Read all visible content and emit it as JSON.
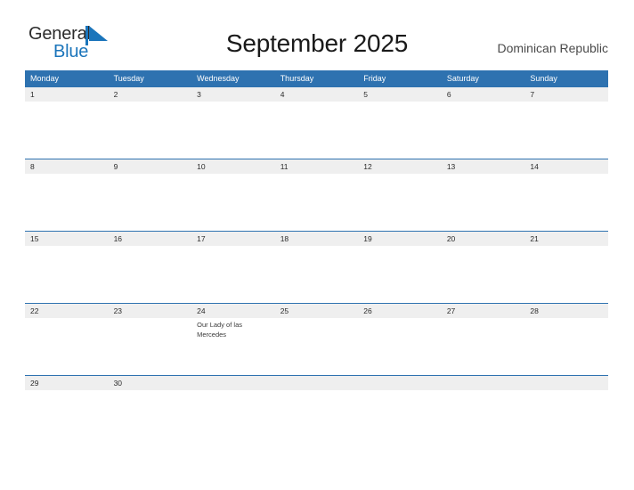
{
  "brand": {
    "name_part1": "General",
    "name_part2": "Blue",
    "flag_icon": "blue-flag-triangle",
    "color_primary": "#1b75bb"
  },
  "header": {
    "title": "September 2025",
    "country": "Dominican Republic"
  },
  "theme": {
    "header_blue": "#2e72b0",
    "band_gray": "#efefef",
    "text_dark": "#2b2b2b",
    "page_background": "#ffffff"
  },
  "calendar": {
    "month": "September",
    "year": "2025",
    "weekday_headers": [
      "Monday",
      "Tuesday",
      "Wednesday",
      "Thursday",
      "Friday",
      "Saturday",
      "Sunday"
    ],
    "weeks": [
      {
        "days": [
          {
            "date": "1",
            "events": []
          },
          {
            "date": "2",
            "events": []
          },
          {
            "date": "3",
            "events": []
          },
          {
            "date": "4",
            "events": []
          },
          {
            "date": "5",
            "events": []
          },
          {
            "date": "6",
            "events": []
          },
          {
            "date": "7",
            "events": []
          }
        ]
      },
      {
        "days": [
          {
            "date": "8",
            "events": []
          },
          {
            "date": "9",
            "events": []
          },
          {
            "date": "10",
            "events": []
          },
          {
            "date": "11",
            "events": []
          },
          {
            "date": "12",
            "events": []
          },
          {
            "date": "13",
            "events": []
          },
          {
            "date": "14",
            "events": []
          }
        ]
      },
      {
        "days": [
          {
            "date": "15",
            "events": []
          },
          {
            "date": "16",
            "events": []
          },
          {
            "date": "17",
            "events": []
          },
          {
            "date": "18",
            "events": []
          },
          {
            "date": "19",
            "events": []
          },
          {
            "date": "20",
            "events": []
          },
          {
            "date": "21",
            "events": []
          }
        ]
      },
      {
        "days": [
          {
            "date": "22",
            "events": []
          },
          {
            "date": "23",
            "events": []
          },
          {
            "date": "24",
            "events": [
              "Our Lady of las Mercedes"
            ]
          },
          {
            "date": "25",
            "events": []
          },
          {
            "date": "26",
            "events": []
          },
          {
            "date": "27",
            "events": []
          },
          {
            "date": "28",
            "events": []
          }
        ]
      },
      {
        "days": [
          {
            "date": "29",
            "events": []
          },
          {
            "date": "30",
            "events": []
          },
          {
            "date": "",
            "events": []
          },
          {
            "date": "",
            "events": []
          },
          {
            "date": "",
            "events": []
          },
          {
            "date": "",
            "events": []
          },
          {
            "date": "",
            "events": []
          }
        ]
      }
    ]
  }
}
